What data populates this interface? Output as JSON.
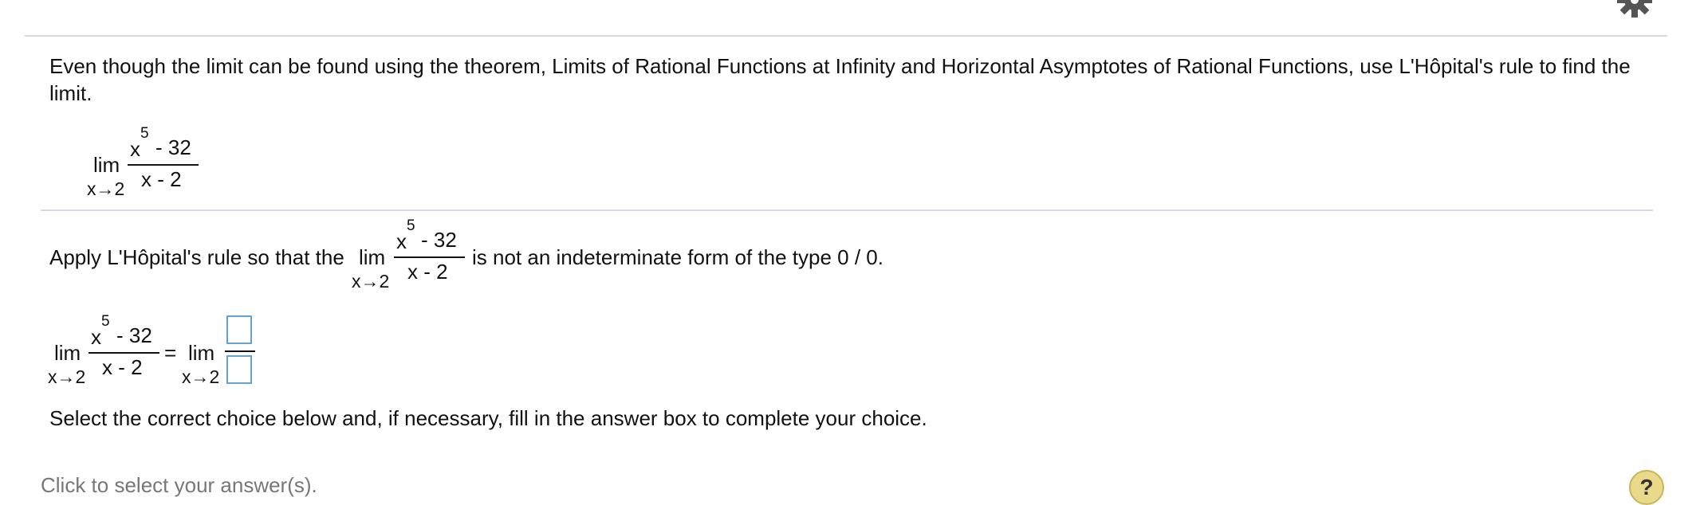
{
  "intro_text": "Even though the limit can be found using the theorem, Limits of Rational Functions at Infinity and Horizontal Asymptotes of Rational Functions, use L'Hôpital's rule to find the limit.",
  "limit": {
    "lim": "lim",
    "subscript": "x→2",
    "numerator_base": "x",
    "numerator_exp": "5",
    "numerator_rest": "- 32",
    "denominator": "x - 2"
  },
  "step": {
    "prefix": "Apply L'Hôpital's rule so that the",
    "suffix": "is not an indeterminate form of the type 0 / 0."
  },
  "equation": {
    "equals": "=",
    "numerator_box": "",
    "denominator_box": ""
  },
  "prompt": "Select the correct choice below and, if necessary, fill in the answer box to complete your choice.",
  "click_to_select": "Click to select your answer(s).",
  "help_label": "?"
}
